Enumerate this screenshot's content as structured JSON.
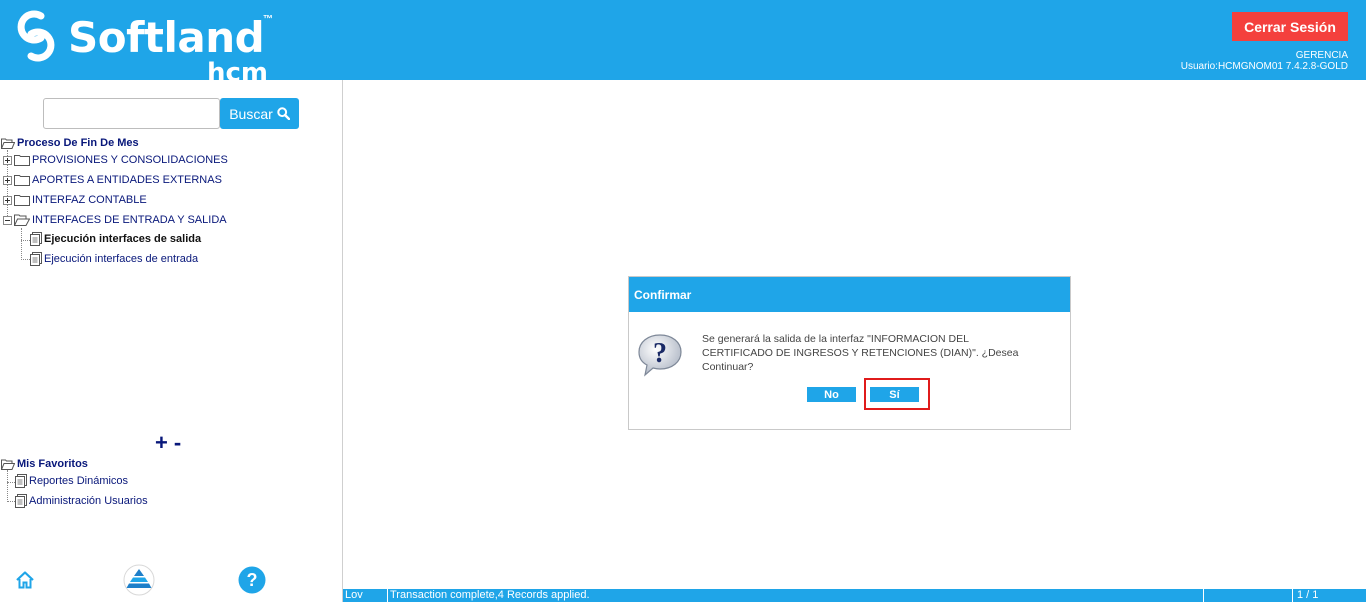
{
  "header": {
    "logo_text": "Softland",
    "logo_tm": "™",
    "logo_sub": "hcm",
    "logout_label": "Cerrar Sesión",
    "company": "GERENCIA",
    "user_line": "Usuario:HCMGNOM01 7.4.2.8-GOLD"
  },
  "search": {
    "value": "",
    "button_label": "Buscar"
  },
  "tree": {
    "root": "Proceso De Fin De Mes",
    "items": [
      {
        "label": "PROVISIONES Y CONSOLIDACIONES"
      },
      {
        "label": "APORTES A ENTIDADES EXTERNAS"
      },
      {
        "label": "INTERFAZ CONTABLE"
      },
      {
        "label": "INTERFACES DE ENTRADA Y SALIDA"
      }
    ],
    "children": [
      {
        "label": "Ejecución interfaces de salida"
      },
      {
        "label": "Ejecución interfaces de entrada"
      }
    ]
  },
  "expand_controls": {
    "plus": "+",
    "minus": "-"
  },
  "favorites": {
    "root": "Mis Favoritos",
    "items": [
      {
        "label": "Reportes Dinámicos"
      },
      {
        "label": "Administración Usuarios"
      }
    ]
  },
  "dialog": {
    "title": "Confirmar",
    "message": "Se generará la salida de la interfaz \"INFORMACION DEL CERTIFICADO DE INGRESOS Y RETENCIONES (DIAN)\". ¿Desea Continuar?",
    "no_label": "No",
    "yes_label": "Sí"
  },
  "status_bar": {
    "mode": "Lov",
    "message": "Transaction complete,4 Records applied.",
    "pages": "1 / 1"
  },
  "colors": {
    "brand_blue": "#1fa5e8",
    "logout_red": "#f4403d",
    "tree_text": "#08177a",
    "highlight_red": "#e01b1b"
  },
  "icons": [
    "softland-logo-icon",
    "search-icon",
    "folder-open-icon",
    "folder-closed-icon",
    "document-icon",
    "home-icon",
    "pyramid-icon",
    "help-icon",
    "question-icon"
  ]
}
